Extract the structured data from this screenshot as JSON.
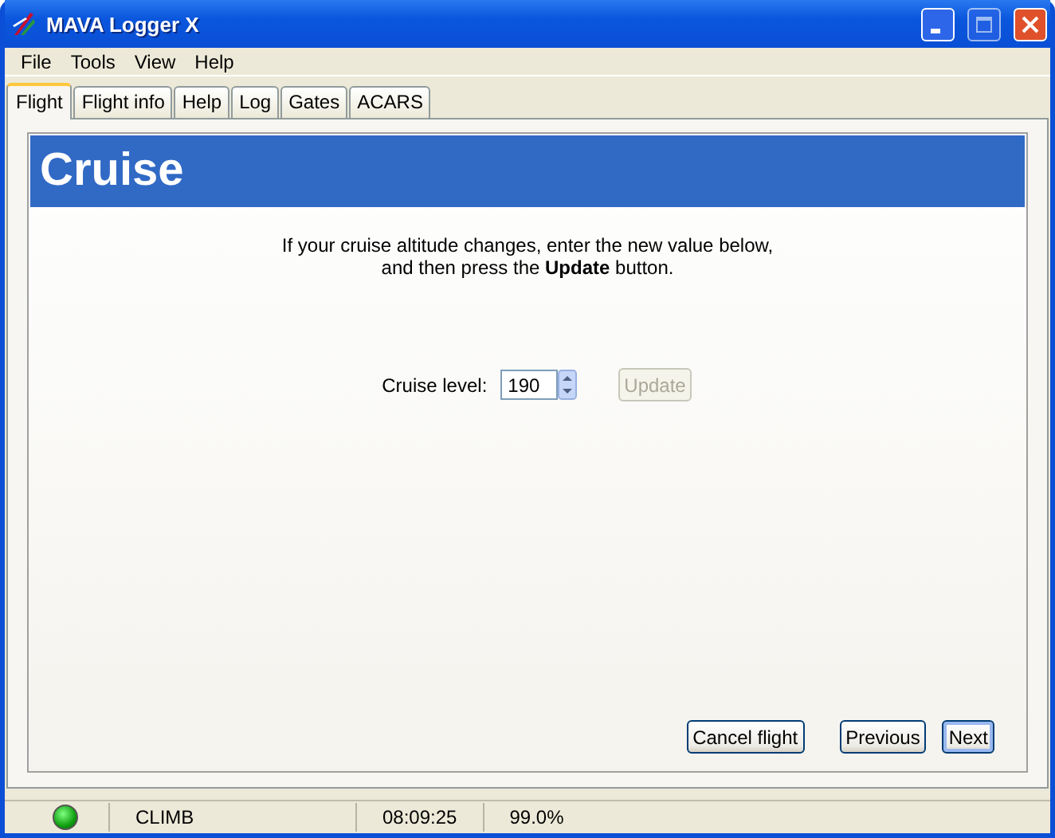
{
  "window": {
    "title": "MAVA Logger X"
  },
  "menu": [
    "File",
    "Tools",
    "View",
    "Help"
  ],
  "tabs": [
    {
      "label": "Flight",
      "selected": true
    },
    {
      "label": "Flight info",
      "selected": false
    },
    {
      "label": "Help",
      "selected": false
    },
    {
      "label": "Log",
      "selected": false
    },
    {
      "label": "Gates",
      "selected": false
    },
    {
      "label": "ACARS",
      "selected": false
    }
  ],
  "page": {
    "heading": "Cruise",
    "instructions": [
      "If your cruise altitude changes, enter the new value below,",
      "and then press the **Update** button."
    ],
    "cruise_level": {
      "label": "Cruise level:",
      "value": "190"
    },
    "update_button": {
      "label": "Update",
      "disabled": true
    }
  },
  "buttons": [
    {
      "label": "Cancel flight",
      "default": false
    },
    {
      "label": "Previous",
      "default": false
    },
    {
      "label": "Next",
      "default": true
    }
  ],
  "status_bar": {
    "indicator_on": true,
    "phase": "CLIMB",
    "time": "08:09:25",
    "percent": "99.0%"
  }
}
